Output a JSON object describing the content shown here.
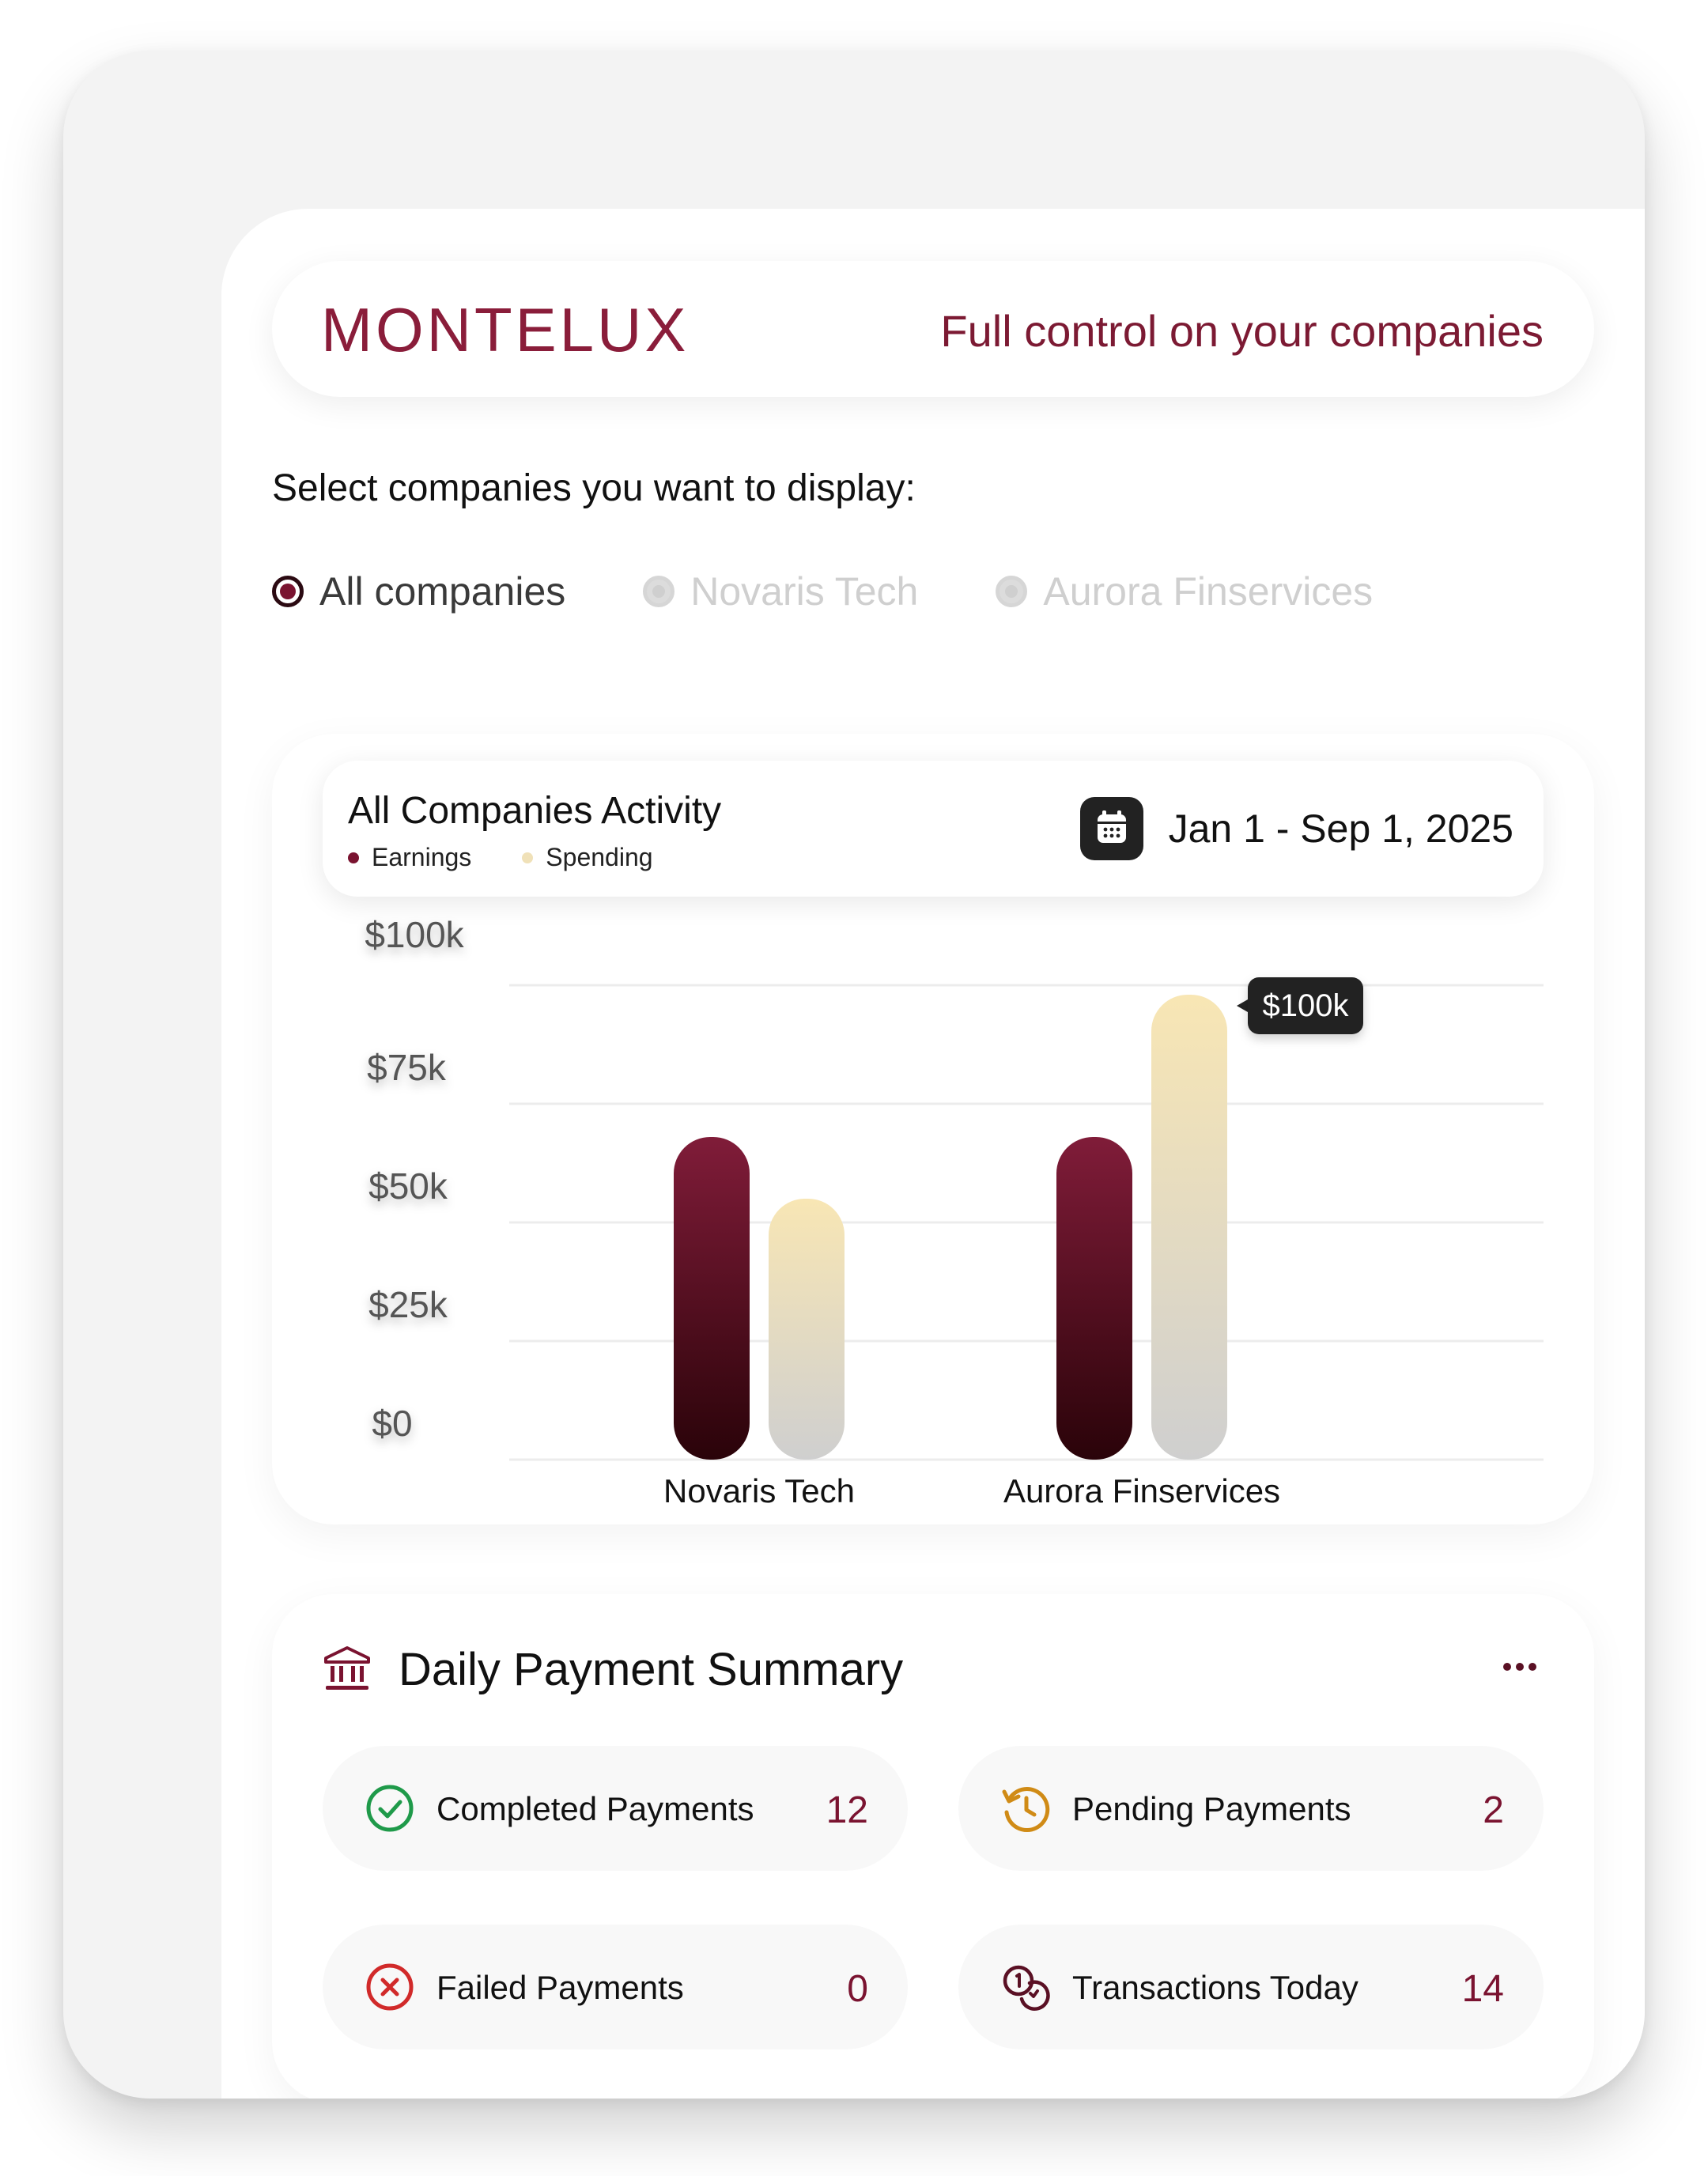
{
  "brand": {
    "logo": "MONTELUX",
    "tagline": "Full control on your companies",
    "accent": "#7a1330"
  },
  "filter": {
    "label": "Select companies you want to display:",
    "options": [
      {
        "label": "All companies",
        "selected": true
      },
      {
        "label": "Novaris Tech",
        "selected": false
      },
      {
        "label": "Aurora Finservices",
        "selected": false
      }
    ]
  },
  "activity": {
    "title": "All Companies Activity",
    "date_range": "Jan 1 - Sep 1, 2025",
    "calendar_icon": "calendar-icon"
  },
  "chart_data": {
    "type": "bar",
    "title": "All Companies Activity",
    "categories": [
      "Novaris Tech",
      "Aurora Finservices"
    ],
    "series": [
      {
        "name": "Earnings",
        "values": [
          68000,
          68000
        ],
        "color": "#7a1330"
      },
      {
        "name": "Spending",
        "values": [
          55000,
          98000
        ],
        "color": "#f3e4b8"
      }
    ],
    "y_ticks": [
      "$100k",
      "$75k",
      "$50k",
      "$25k",
      "$0"
    ],
    "ylim": [
      0,
      100000
    ],
    "tooltip": "$100k",
    "legend_position": "top-left",
    "grid": true
  },
  "payments": {
    "title": "Daily Payment Summary",
    "stats": [
      {
        "label": "Completed Payments",
        "value": "12",
        "icon": "check-circle-icon"
      },
      {
        "label": "Pending Payments",
        "value": "2",
        "icon": "history-icon"
      },
      {
        "label": "Failed Payments",
        "value": "0",
        "icon": "x-circle-icon"
      },
      {
        "label": "Transactions Today",
        "value": "14",
        "icon": "coins-icon"
      }
    ]
  }
}
